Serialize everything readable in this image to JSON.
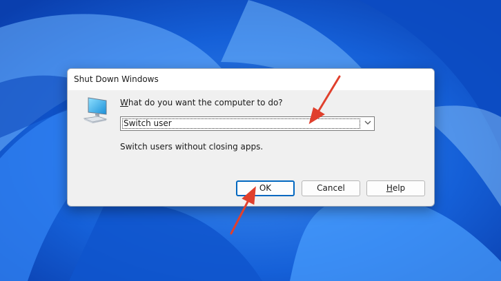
{
  "dialog": {
    "title": "Shut Down Windows",
    "prompt_first": "W",
    "prompt_rest": "hat do you want the computer to do?",
    "selected_option": "Switch user",
    "description": "Switch users without closing apps.",
    "ok_label": "OK",
    "cancel_label": "Cancel",
    "help_first": "H",
    "help_rest": "elp"
  },
  "icons": {
    "computer": "computer-icon",
    "dropdown": "chevron-down-icon"
  },
  "colors": {
    "wallpaper": "#1b6fe6",
    "accent": "#0067c0",
    "annotation_arrow": "#e0402d"
  }
}
